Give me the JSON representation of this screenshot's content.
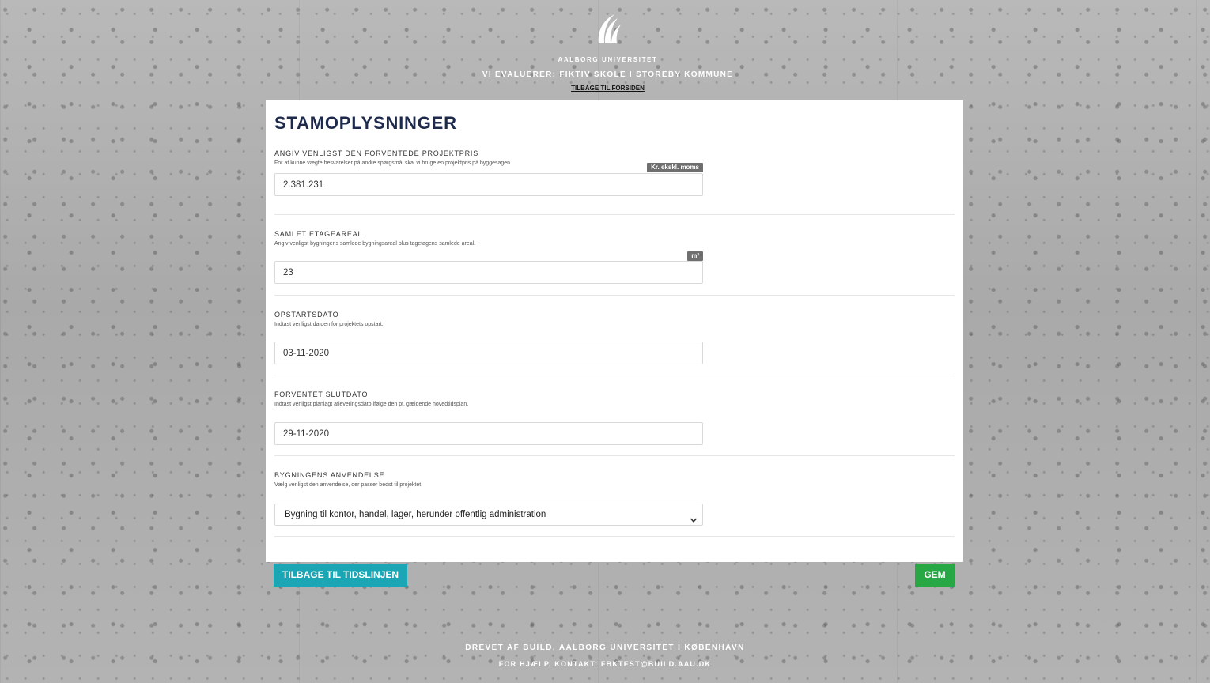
{
  "header": {
    "university": "AALBORG UNIVERSITET",
    "evaluating": "VI EVALUERER: FIKTIV SKOLE I STOREBY KOMMUNE",
    "back_link": "TILBAGE TIL FORSIDEN",
    "logo_icon": "aau-logo-icon"
  },
  "card": {
    "title": "STAMOPLYSNINGER",
    "fields": [
      {
        "label": "ANGIV VENLIGST DEN FORVENTEDE PROJEKTPRIS",
        "help": "For at kunne vægte besvarelser på andre spørgsmål skal vi bruge en projektpris på byggesagen.",
        "unit": "Kr. ekskl. moms",
        "value": "2.381.231"
      },
      {
        "label": "SAMLET ETAGEAREAL",
        "help": "Angiv venligst bygningens samlede bygningsareal plus tagetagens samlede areal.",
        "unit": "m²",
        "value": "23"
      },
      {
        "label": "OPSTARTSDATO",
        "help": "Indtast venligst datoen for projektets opstart.",
        "value": "03-11-2020"
      },
      {
        "label": "FORVENTET SLUTDATO",
        "help": "Indtast venligst planlagt afleveringsdato ifølge den pt. gældende hovedtidsplan.",
        "value": "29-11-2020"
      },
      {
        "label": "BYGNINGENS ANVENDELSE",
        "help": "Vælg venligst den anvendelse, der passer bedst til projektet.",
        "value": "Bygning til kontor, handel, lager, herunder offentlig administration",
        "icon": "chevron-down-icon"
      }
    ]
  },
  "buttons": {
    "back": "TILBAGE TIL TIDSLINJEN",
    "save": "GEM"
  },
  "footer": {
    "line1": "DREVET AF BUILD, AALBORG UNIVERSITET I KØBENHAVN",
    "line2": "FOR HJÆLP, KONTAKT: FBKTEST@BUILD.AAU.DK"
  },
  "colors": {
    "title": "#1e2a4c",
    "back_button": "#1ba6b5",
    "save_button": "#27a845",
    "unit_badge": "#6f6f6f"
  }
}
